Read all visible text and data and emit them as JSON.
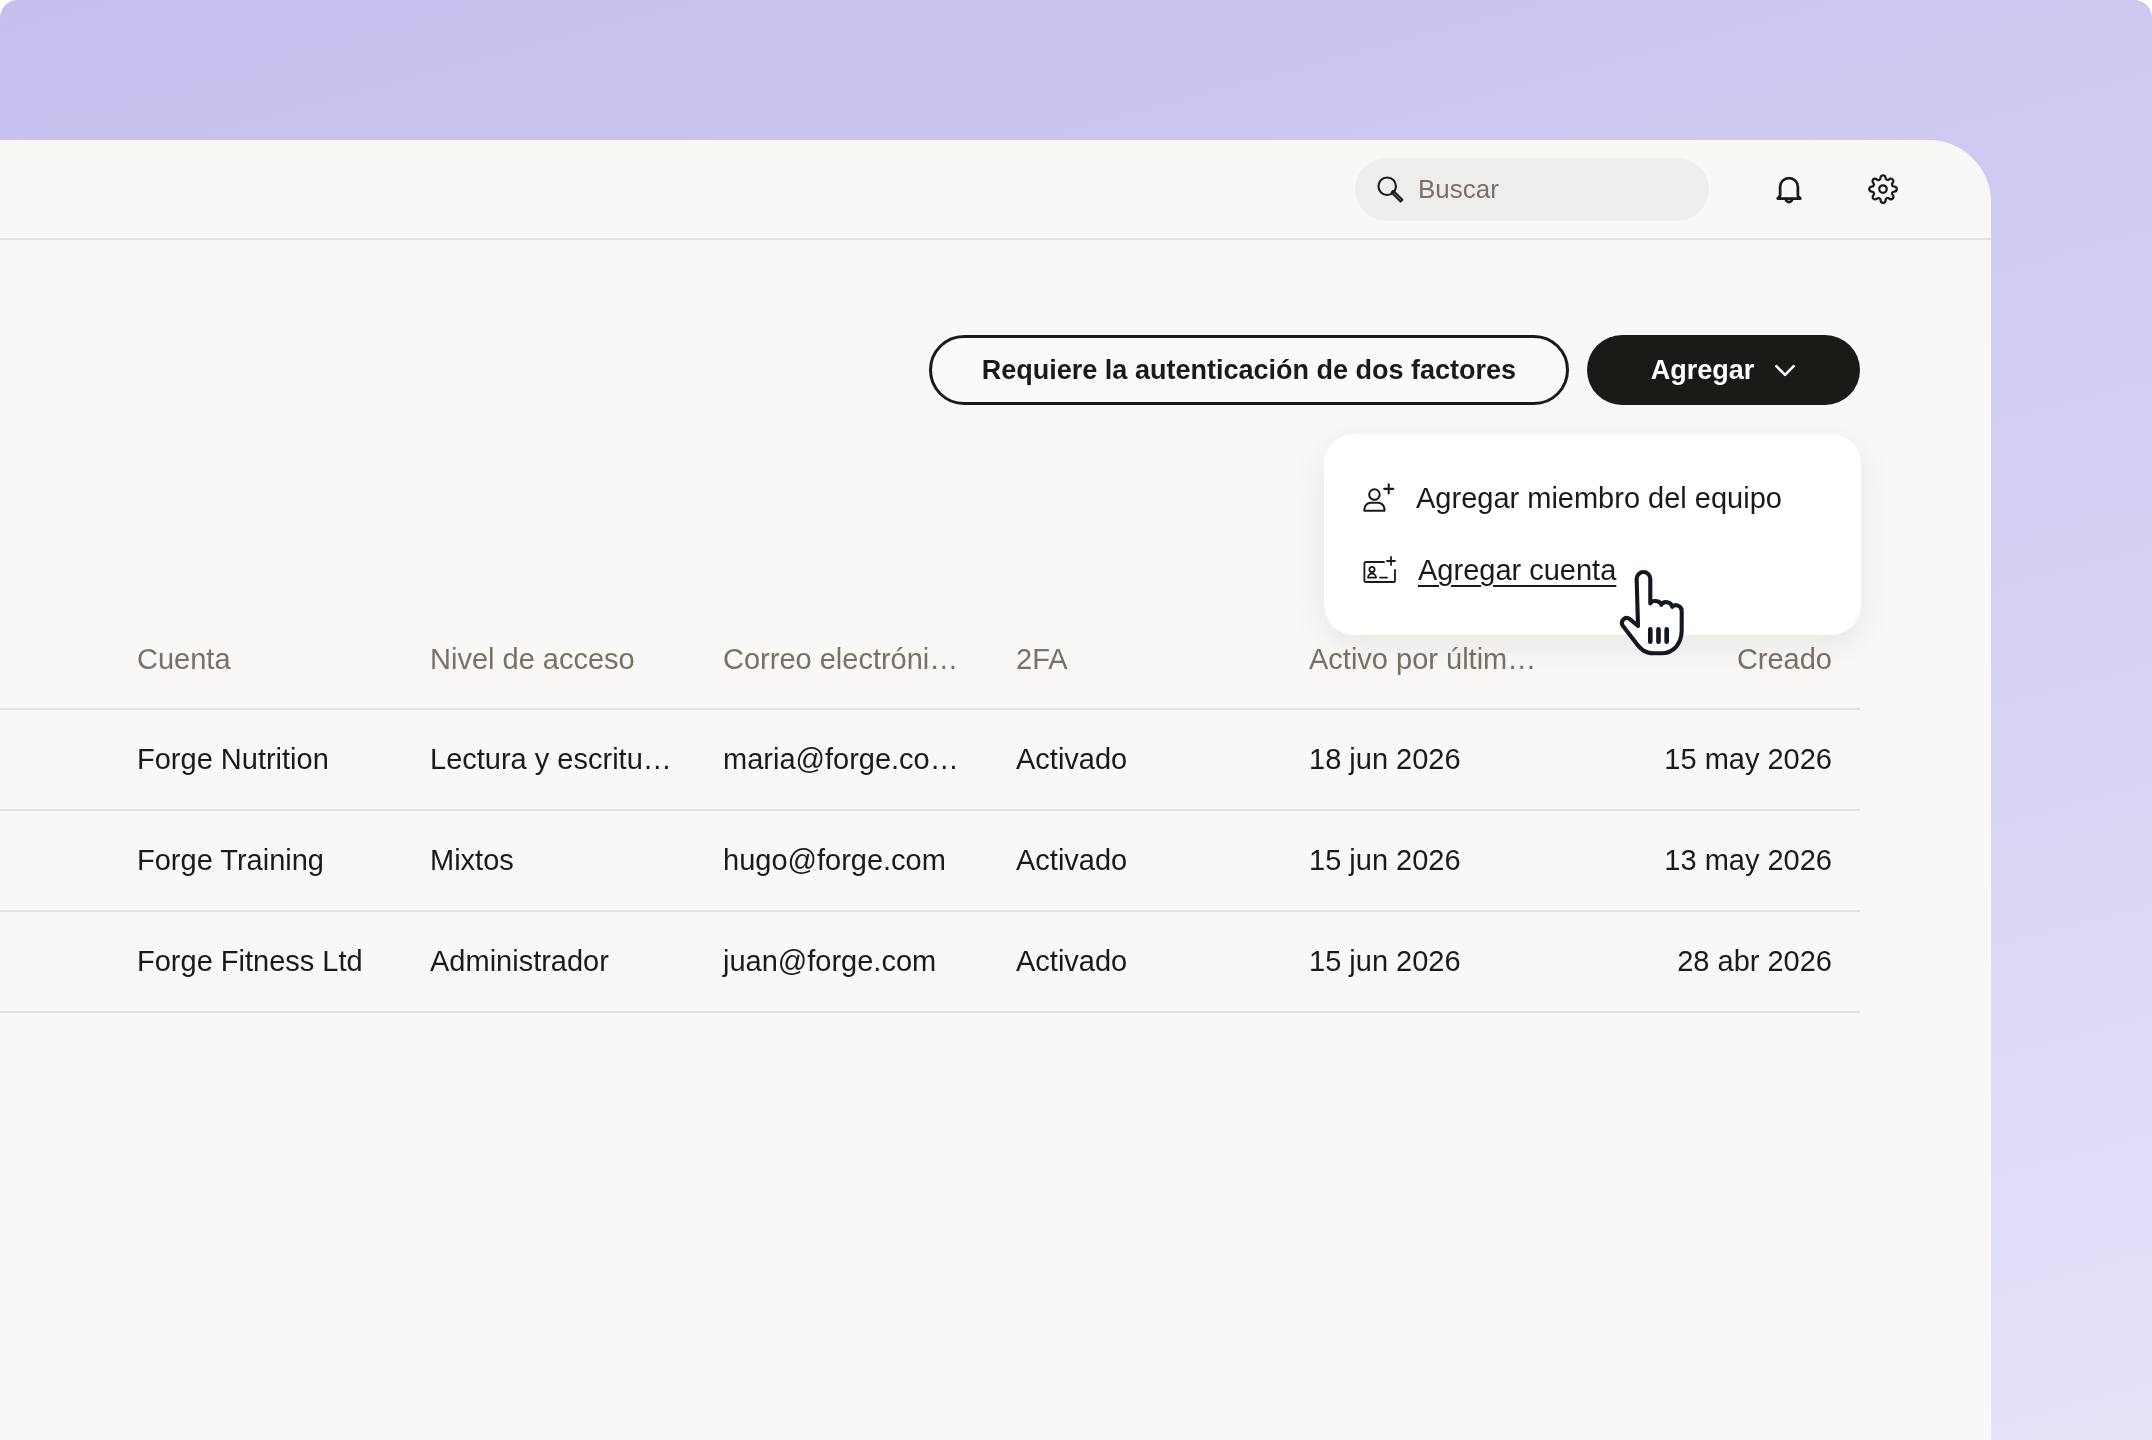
{
  "topbar": {
    "search": {
      "placeholder": "Buscar"
    }
  },
  "actions": {
    "buttons": [
      {
        "label": "Requiere la autenticación de dos factores",
        "kind": "outline"
      },
      {
        "label": "Agregar",
        "kind": "primary",
        "menu": [
          {
            "label": "Agregar miembro del equipo",
            "kind": "member",
            "hovered": false
          },
          {
            "label": "Agregar cuenta",
            "kind": "account",
            "hovered": true
          }
        ]
      }
    ]
  },
  "table": {
    "columns": [
      "Cuenta",
      "Nivel de acceso",
      "Correo electróni…",
      "2FA",
      "Activo por últim…",
      "Creado"
    ],
    "rows": [
      [
        "Forge Nutrition",
        "Lectura y escritu…",
        "maria@forge.co…",
        "Activado",
        "18 jun 2026",
        "15 may 2026"
      ],
      [
        "Forge Training",
        "Mixtos",
        "hugo@forge.com",
        "Activado",
        "15 jun 2026",
        "13 may 2026"
      ],
      [
        "Forge Fitness Ltd",
        "Administrador",
        "juan@forge.com",
        "Activado",
        "15 jun 2026",
        "28 abr 2026"
      ]
    ]
  }
}
